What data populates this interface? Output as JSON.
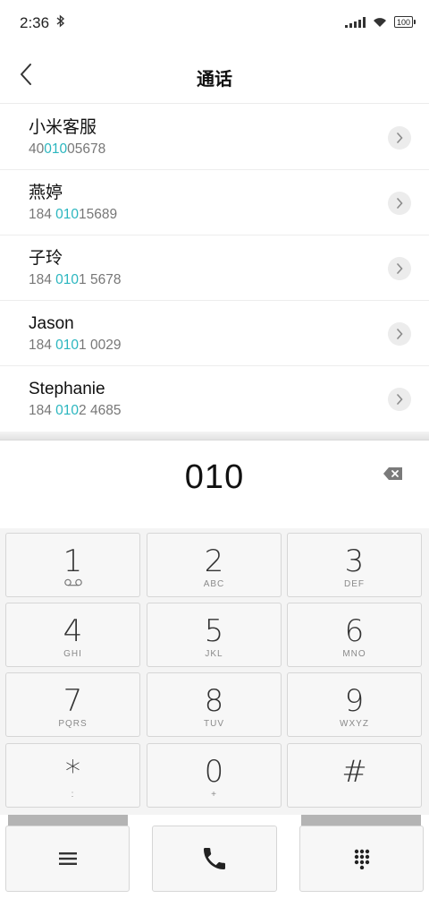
{
  "status": {
    "time": "2:36",
    "battery": "100"
  },
  "header": {
    "title": "通话"
  },
  "contacts": [
    {
      "name": "小米客服",
      "num_pre": "40",
      "num_match": "010",
      "num_post": "05678"
    },
    {
      "name": "燕婷",
      "num_pre": "184 ",
      "num_match": "010",
      "num_post": "15689"
    },
    {
      "name": "子玲",
      "num_pre": "184 ",
      "num_match": "010",
      "num_post": "1 5678"
    },
    {
      "name": "Jason",
      "num_pre": "184 ",
      "num_match": "010",
      "num_post": "1 0029"
    },
    {
      "name": "Stephanie",
      "num_pre": "184 ",
      "num_match": "010",
      "num_post": "2 4685"
    }
  ],
  "dialer": {
    "value": "010"
  },
  "keys": [
    {
      "digit": "1",
      "sub": ""
    },
    {
      "digit": "2",
      "sub": "ABC"
    },
    {
      "digit": "3",
      "sub": "DEF"
    },
    {
      "digit": "4",
      "sub": "GHI"
    },
    {
      "digit": "5",
      "sub": "JKL"
    },
    {
      "digit": "6",
      "sub": "MNO"
    },
    {
      "digit": "7",
      "sub": "PQRS"
    },
    {
      "digit": "8",
      "sub": "TUV"
    },
    {
      "digit": "9",
      "sub": "WXYZ"
    },
    {
      "digit": "*",
      "sub": ":"
    },
    {
      "digit": "0",
      "sub": "+"
    },
    {
      "digit": "#",
      "sub": ""
    }
  ],
  "icons": {
    "back": "back-arrow-icon",
    "detail": "chevron-right-icon",
    "backspace": "backspace-icon",
    "menu": "menu-icon",
    "call": "phone-icon",
    "keypad": "keypad-icon",
    "voicemail": "voicemail-icon"
  },
  "colors": {
    "match_highlight": "#2bb6bf",
    "text": "#1a1a1a",
    "subtext": "#777777"
  }
}
